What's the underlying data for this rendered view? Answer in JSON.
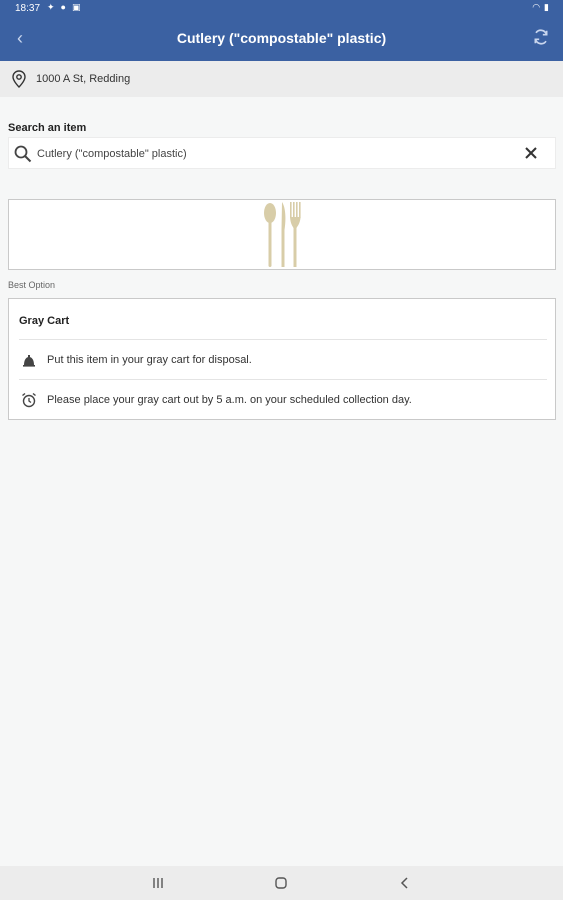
{
  "status_bar": {
    "time": "18:37"
  },
  "app_bar": {
    "title": "Cutlery (\"compostable\" plastic)"
  },
  "location": {
    "address": "1000 A St, Redding"
  },
  "search": {
    "label": "Search an item",
    "value": "Cutlery (\"compostable\" plastic)"
  },
  "best_option_label": "Best Option",
  "card": {
    "title": "Gray Cart",
    "rows": [
      {
        "icon": "bell-icon",
        "text": "Put this item in your gray cart for disposal."
      },
      {
        "icon": "alarm-clock-icon",
        "text": "Please place your gray cart out by 5 a.m. on your scheduled collection day."
      }
    ]
  },
  "colors": {
    "brand": "#3b61a2",
    "utensil": "#d8cda8"
  }
}
